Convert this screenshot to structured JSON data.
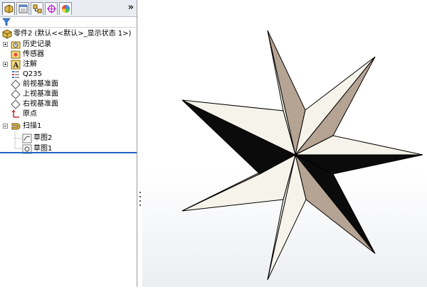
{
  "panel": {
    "tabs": [
      {
        "name": "feature-manager-tab-icon"
      },
      {
        "name": "property-manager-tab-icon"
      },
      {
        "name": "configuration-manager-tab-icon"
      },
      {
        "name": "dimxpert-tab-icon"
      },
      {
        "name": "display-manager-tab-icon"
      }
    ],
    "overflow": "»"
  },
  "tree": {
    "root": "零件2  (默认<<默认>_显示状态 1>)",
    "items": [
      {
        "label": "历史记录",
        "icon": "history-folder-icon"
      },
      {
        "label": "传感器",
        "icon": "sensors-icon"
      },
      {
        "label": "注解",
        "icon": "annotations-icon"
      },
      {
        "label": "Q235",
        "icon": "material-icon"
      },
      {
        "label": "前视基准面",
        "icon": "plane-icon"
      },
      {
        "label": "上视基准面",
        "icon": "plane-icon"
      },
      {
        "label": "右视基准面",
        "icon": "plane-icon"
      },
      {
        "label": "原点",
        "icon": "origin-icon"
      },
      {
        "label": "扫描1",
        "icon": "sweep-feature-icon"
      },
      {
        "label": "草图2",
        "icon": "sketch-icon"
      },
      {
        "label": "草图1",
        "icon": "sketch-icon"
      }
    ]
  },
  "colors": {
    "star_dark": "#0b0b0b",
    "star_tan": "#b8a898",
    "star_light": "#f8f6ec",
    "selection_line": "#1e62c8"
  }
}
